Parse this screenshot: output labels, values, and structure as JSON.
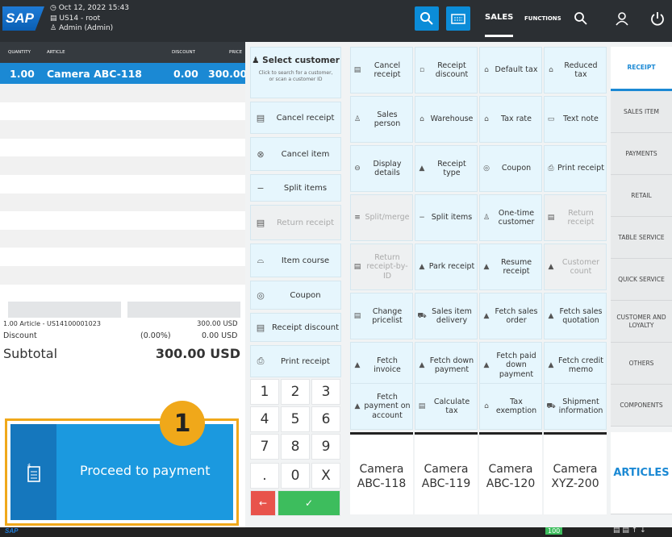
{
  "header": {
    "logo": "SAP",
    "date": "Oct 12, 2022 15:43",
    "store": "US14 - root",
    "user": "Admin (Admin)",
    "sales_label": "SALES",
    "functions_label": "FUNCTIONS"
  },
  "table": {
    "col_quantity": "QUANTITY",
    "col_article": "ARTICLE",
    "col_discount": "DISCOUNT",
    "col_price": "PRICE",
    "row": {
      "qty": "1.00",
      "article": "Camera ABC-118",
      "discount": "0.00",
      "price": "300.00"
    }
  },
  "summary": {
    "article_line": "1.00 Article - US141000010​23",
    "article_amount": "300.00 USD",
    "discount_label": "Discount",
    "discount_pct": "(0.00%)",
    "discount_amount": "0.00 USD",
    "subtotal_label": "Subtotal",
    "subtotal_amount": "300.00 USD"
  },
  "proceed": {
    "label": "Proceed to payment",
    "badge": "1"
  },
  "mid": {
    "select_customer": "Select customer",
    "select_customer_hint": "Click to search for a customer, or scan a customer ID",
    "buttons": [
      {
        "label": "Cancel receipt"
      },
      {
        "label": "Cancel item"
      },
      {
        "label": "Split items"
      },
      {
        "label": "Return receipt"
      },
      {
        "label": "Item course"
      },
      {
        "label": "Coupon"
      },
      {
        "label": "Receipt discount"
      },
      {
        "label": "Print receipt"
      }
    ]
  },
  "keypad": [
    "1",
    "2",
    "3",
    "4",
    "5",
    "6",
    "7",
    "8",
    "9",
    ".",
    "0",
    "X"
  ],
  "keypad_back": "←",
  "keypad_ok": "✓",
  "grid": [
    [
      "Cancel receipt",
      "Receipt discount",
      "Default tax",
      "Reduced tax"
    ],
    [
      "Sales person",
      "Warehouse",
      "Tax rate",
      "Text note"
    ],
    [
      "Display details",
      "Receipt type",
      "Coupon",
      "Print receipt"
    ],
    [
      "Split/merge",
      "Split items",
      "One-time customer",
      "Return receipt"
    ],
    [
      "Return receipt-by-ID",
      "Park receipt",
      "Resume receipt",
      "Customer count"
    ],
    [
      "Change pricelist",
      "Sales item delivery",
      "Fetch sales order",
      "Fetch sales quotation"
    ],
    [
      "Fetch invoice",
      "Fetch down payment",
      "Fetch paid down payment",
      "Fetch credit memo"
    ],
    [
      "Fetch payment on account",
      "Calculate tax",
      "Tax exemption",
      "Shipment information"
    ]
  ],
  "articles": [
    "Camera ABC-118",
    "Camera ABC-119",
    "Camera ABC-120",
    "Camera XYZ-200"
  ],
  "tabs": [
    "RECEIPT",
    "SALES ITEM",
    "PAYMENTS",
    "RETAIL",
    "TABLE SERVICE",
    "QUICK SERVICE",
    "CUSTOMER AND LOYALTY",
    "OTHERS",
    "COMPONENTS",
    "ARTICLES"
  ],
  "footer": {
    "logo": "SAP",
    "counter": "100"
  }
}
